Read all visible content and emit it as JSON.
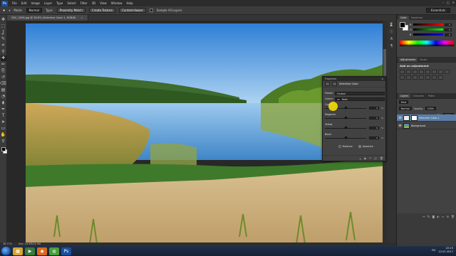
{
  "menu": {
    "logo": "Ps",
    "items": [
      "File",
      "Edit",
      "Image",
      "Layer",
      "Type",
      "Select",
      "Filter",
      "3D",
      "View",
      "Window",
      "Help"
    ],
    "win_controls": [
      "–",
      "□",
      "✕"
    ]
  },
  "options": {
    "mode_label": "Mode:",
    "mode_value": "Normal",
    "type_label": "Type:",
    "type_value": "Proximity Match",
    "create_texture": "Create Texture",
    "content_aware": "Content-Aware",
    "sample_all": "Sample All Layers",
    "workspace": "Essentials"
  },
  "document": {
    "tab_title": "DSC_0058.jpg @ 36.8% (Selective Color 1, RGB/8)",
    "close": "×"
  },
  "status": {
    "zoom": "36.77%",
    "doc": "Doc: 24.9M/24.9M"
  },
  "tools": [
    "move-icon",
    "marquee-icon",
    "lasso-icon",
    "quick-select-icon",
    "crop-icon",
    "eyedropper-icon",
    "healing-icon",
    "brush-icon",
    "clone-stamp-icon",
    "history-brush-icon",
    "eraser-icon",
    "gradient-icon",
    "blur-icon",
    "dodge-icon",
    "pen-icon",
    "type-icon",
    "path-select-icon",
    "shape-icon",
    "hand-icon",
    "zoom-icon"
  ],
  "tool_glyphs": [
    "✥",
    "⬚",
    "ʆ",
    "✎",
    "⌗",
    "⚲",
    "✚",
    "✏",
    "⎘",
    "↺",
    "⌫",
    "▤",
    "◔",
    "◖",
    "✒",
    "T",
    "➤",
    "▭",
    "✋",
    "⚲"
  ],
  "color_panel": {
    "tabs": [
      "Color",
      "Swatches"
    ],
    "channels": [
      {
        "name": "R",
        "value": "0",
        "gradient": "linear-gradient(90deg,#000,#f00)"
      },
      {
        "name": "G",
        "value": "0",
        "gradient": "linear-gradient(90deg,#000,#0f0)"
      },
      {
        "name": "B",
        "value": "0",
        "gradient": "linear-gradient(90deg,#000,#00f)"
      }
    ]
  },
  "adjustments": {
    "tabs": [
      "Adjustments",
      "Styles"
    ],
    "title": "Add an adjustment"
  },
  "layers": {
    "tabs": [
      "Layers",
      "Channels",
      "Paths"
    ],
    "kind": "Kind",
    "blend_mode": "Normal",
    "opacity_label": "Opacity:",
    "opacity": "100%",
    "fill_label": "Fill:",
    "fill": "100%",
    "rows": [
      {
        "name": "Selective Color 1",
        "selected": true
      },
      {
        "name": "Background",
        "selected": false
      }
    ],
    "footer_icons": [
      "link-icon",
      "fx-icon",
      "mask-icon",
      "adjustment-icon",
      "folder-icon",
      "new-layer-icon",
      "trash-icon"
    ],
    "footer_glyphs": [
      "⚯",
      "fx",
      "◙",
      "◐",
      "▭",
      "⊞",
      "🗑"
    ]
  },
  "properties": {
    "panel_tab": "Properties",
    "title": "Selective Color",
    "preset_label": "Preset:",
    "preset_value": "Custom",
    "colors_label": "Colors:",
    "colors_value": "Reds",
    "sliders": [
      {
        "name": "Cyan",
        "value": "0",
        "pct": "%",
        "position": 0.5
      },
      {
        "name": "Magenta",
        "value": "0",
        "pct": "%",
        "position": 0.5
      },
      {
        "name": "Yellow",
        "value": "0",
        "pct": "%",
        "position": 0.5
      },
      {
        "name": "Black",
        "value": "0",
        "pct": "%",
        "position": 0.5
      }
    ],
    "relative": "Relative",
    "absolute": "Absolute",
    "method_selected": "absolute",
    "footer_glyphs": [
      "⤓",
      "◉",
      "↶",
      "◎",
      "🗑"
    ]
  },
  "taskbar": {
    "apps": [
      {
        "name": "explorer-icon",
        "glyph": "▦",
        "color": "#d9a531"
      },
      {
        "name": "media-player-icon",
        "glyph": "▶",
        "color": "#3a7a3a"
      },
      {
        "name": "firefox-icon",
        "glyph": "◉",
        "color": "#d86a1c"
      },
      {
        "name": "chrome-icon",
        "glyph": "◍",
        "color": "#4a9c3c"
      },
      {
        "name": "photoshop-icon",
        "glyph": "Ps",
        "color": "#1b4f9c"
      }
    ],
    "language": "RU",
    "time": "22:15",
    "date": "12.01.2017"
  }
}
